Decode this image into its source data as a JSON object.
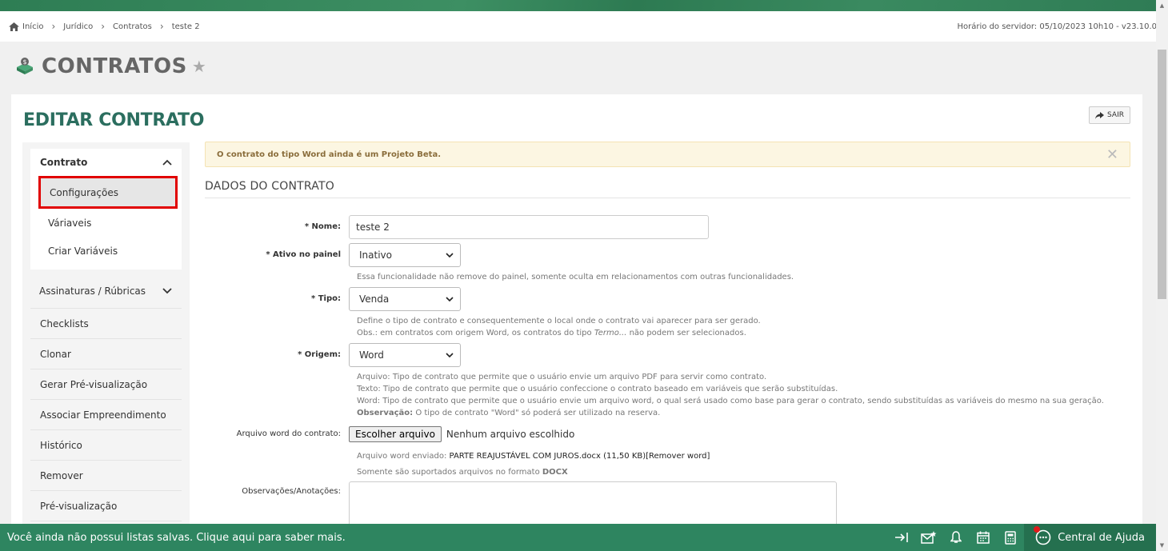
{
  "breadcrumb": [
    "Início",
    "Jurídico",
    "Contratos",
    "teste 2"
  ],
  "server_time": "Horário do servidor: 05/10/2023 10h10 - v23.10.0",
  "page_title": "CONTRATOS",
  "edit_title": "EDITAR CONTRATO",
  "exit_label": "SAIR",
  "sidebar": {
    "group_label": "Contrato",
    "sub_items": [
      "Configurações",
      "Váriaveis",
      "Criar Variáveis"
    ],
    "items": [
      "Assinaturas / Rúbricas",
      "Checklists",
      "Clonar",
      "Gerar Pré-visualização",
      "Associar Empreendimento",
      "Histórico",
      "Remover",
      "Pré-visualização"
    ]
  },
  "alert": "O contrato do tipo Word ainda é um Projeto Beta.",
  "section_title": "DADOS DO CONTRATO",
  "form": {
    "nome_label": "* Nome:",
    "nome_value": "teste 2",
    "ativo_label": "* Ativo no painel",
    "ativo_value": "Inativo",
    "ativo_help": "Essa funcionalidade não remove do painel, somente oculta em relacionamentos com outras funcionalidades.",
    "tipo_label": "* Tipo:",
    "tipo_value": "Venda",
    "tipo_help1": "Define o tipo de contrato e consequentemente o local onde o contrato vai aparecer para ser gerado.",
    "tipo_help2_a": "Obs.: em contratos com origem Word, os contratos do tipo ",
    "tipo_help2_em": "Termo...",
    "tipo_help2_b": " não podem ser selecionados.",
    "origem_label": "* Origem:",
    "origem_value": "Word",
    "origem_help1": "Arquivo: Tipo de contrato que permite que o usuário envie um arquivo PDF para servir como contrato.",
    "origem_help2": "Texto: Tipo de contrato que permite que o usuário confeccione o contrato baseado em variáveis que serão substituídas.",
    "origem_help3": "Word: Tipo de contrato que permite que o usuário envie um arquivo word, o qual será usado como base para gerar o contrato, sendo substituídas as variáveis do mesmo na sua geração.",
    "origem_help4_b": "Observação:",
    "origem_help4": " O tipo de contrato \"Word\" só poderá ser utilizado na reserva.",
    "arquivo_label": "Arquivo word do contrato:",
    "arquivo_button": "Escolher arquivo",
    "arquivo_none": "Nenhum arquivo escolhido",
    "arquivo_sent_label": "Arquivo word enviado: ",
    "arquivo_sent_value": "PARTE REAJUSTÁVEL COM JUROS.docx (11,50 KB)[Remover word]",
    "arquivo_support_a": "Somente são suportados arquivos no formato ",
    "arquivo_support_b": "DOCX",
    "obs_label": "Observações/Anotações:"
  },
  "footer": {
    "message": "Você ainda não possui listas salvas. Clique aqui para saber mais.",
    "help_label": "Central de Ajuda"
  }
}
